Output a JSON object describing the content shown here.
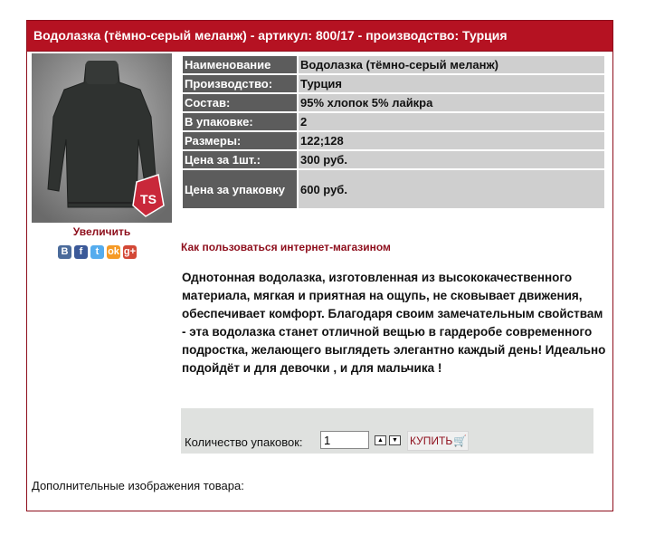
{
  "product": {
    "title": "Водолазка (тёмно-серый меланж) - артикул: 800/17 - производство: Турция",
    "enlarge_label": "Увеличить",
    "watermark_logo": "TS",
    "social_icons": [
      "vkontakte-icon",
      "facebook-icon",
      "twitter-icon",
      "odnoklassniki-icon",
      "google-plus-icon"
    ],
    "social_glyphs": [
      "B",
      "f",
      "t",
      "ok",
      "g+"
    ],
    "social_colors": [
      "#4b6b9b",
      "#3b5998",
      "#55acee",
      "#f59a25",
      "#d34836"
    ],
    "specs": [
      {
        "label": "Наименование",
        "value": "Водолазка (тёмно-серый меланж)"
      },
      {
        "label": "Производство:",
        "value": "Турция"
      },
      {
        "label": "Состав:",
        "value": "95% хлопок 5% лайкра"
      },
      {
        "label": "В упаковке:",
        "value": "2"
      },
      {
        "label": "Размеры:",
        "value": "122;128"
      },
      {
        "label": "Цена за 1шт.:",
        "value": "300 руб."
      },
      {
        "label": "Цена за упаковку",
        "value": "600 руб."
      }
    ],
    "howto_link": "Как пользоваться интернет-магазином",
    "description": "Однотонная водолазка, изготовленная из высококачественного материала, мягкая и приятная на ощупь, не сковывает движения, обеспечивает комфорт. Благодаря своим замечательным свойствам - эта водолазка станет отличной вещью в гардеробе современного подростка, желающего выглядеть элегантно каждый день! Идеально подойдёт и для девочки , и для мальчика !",
    "order": {
      "qty_label": "Количество упаковок:",
      "qty_value": "1",
      "buy_label": "КУПИТЬ"
    },
    "extra_images_label": "Дополнительные изображения товара:"
  },
  "colors": {
    "accent": "#b51222",
    "label_bg": "#5c5c5c",
    "value_bg": "#cfcfcf"
  }
}
